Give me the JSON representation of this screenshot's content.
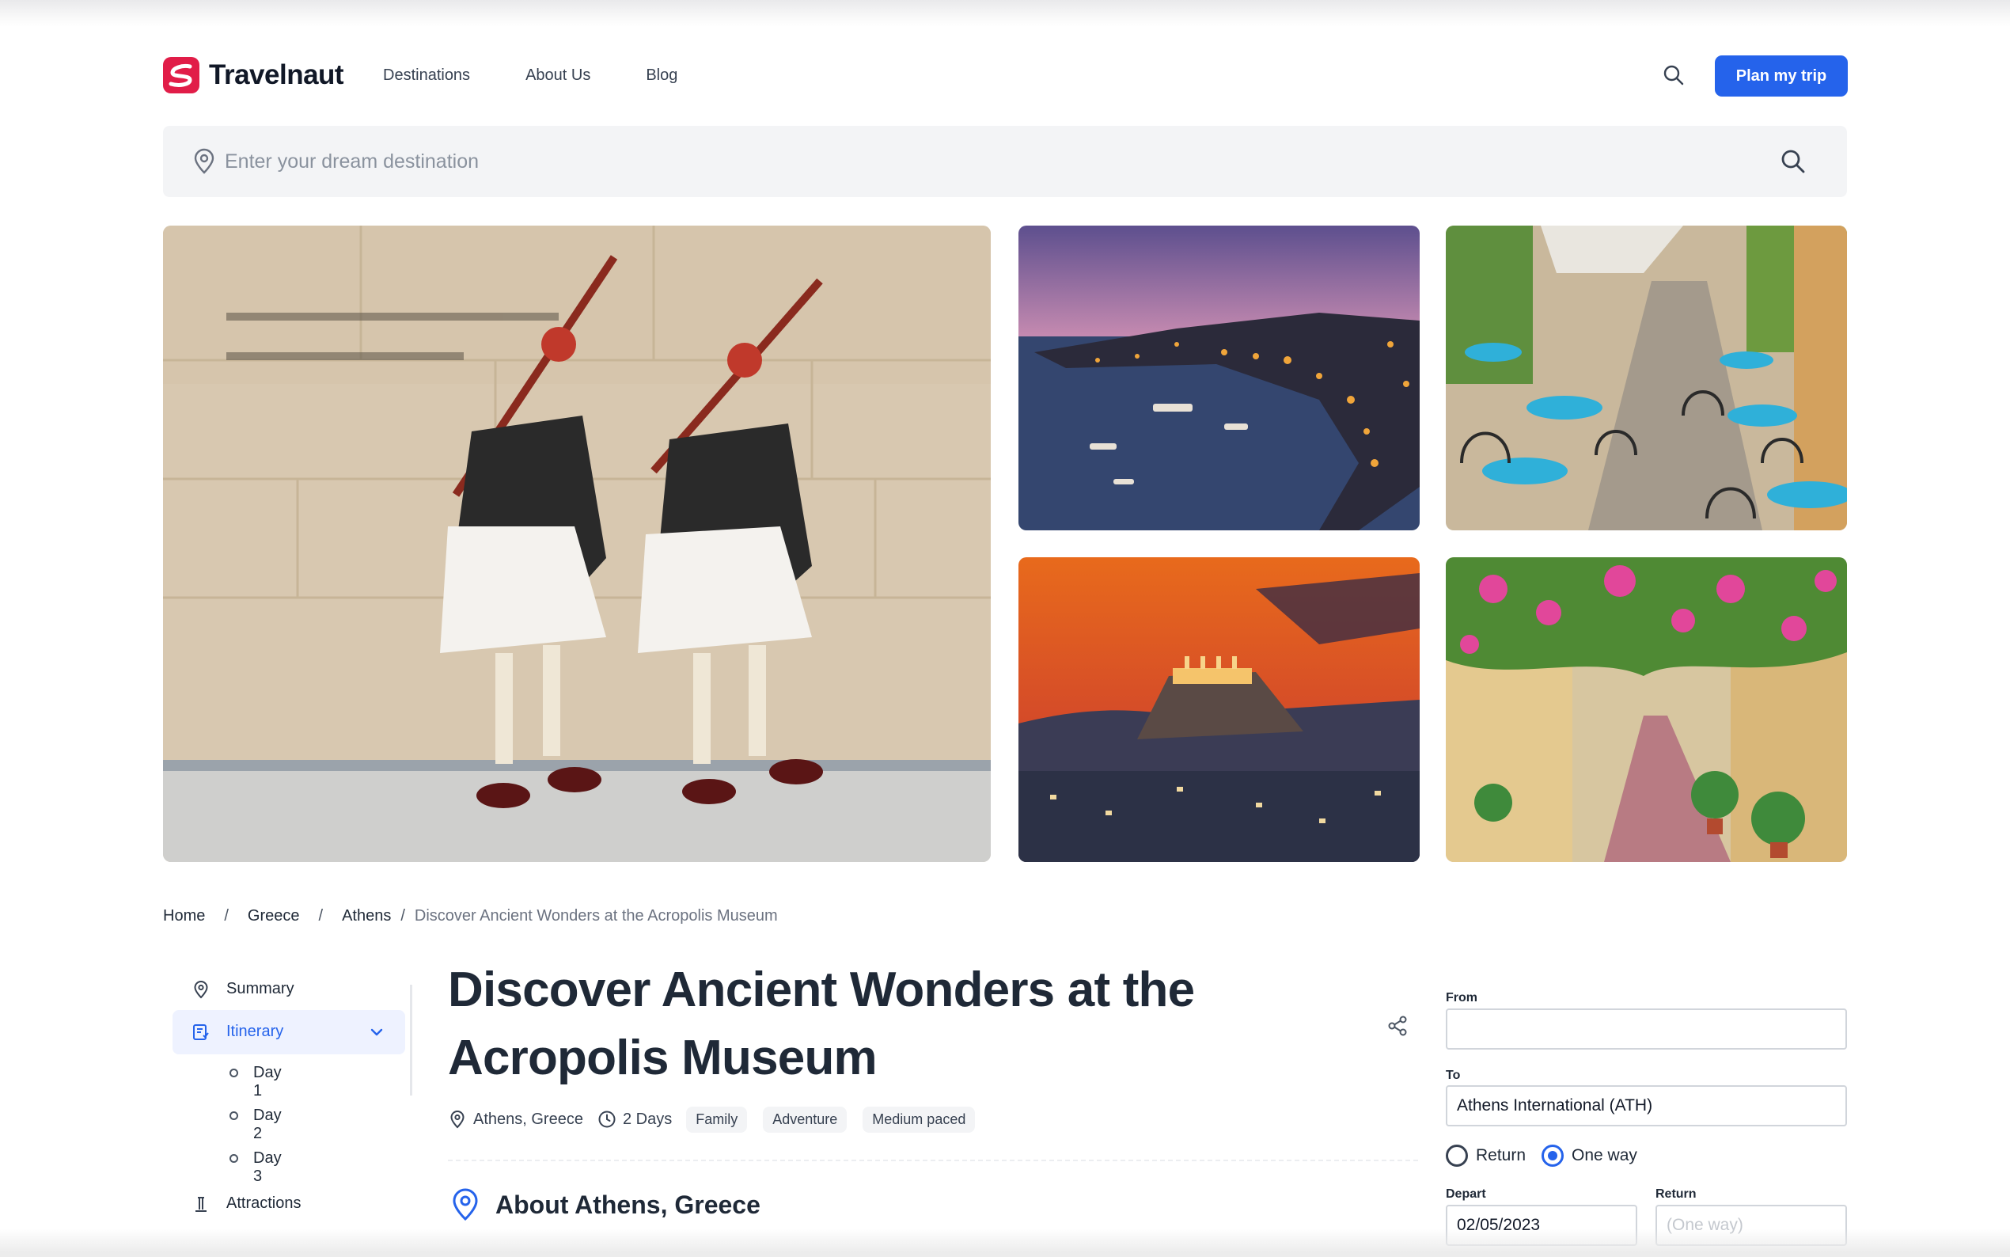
{
  "brand": {
    "name": "Travelnaut",
    "accent": "#e11d48",
    "primary": "#2563eb"
  },
  "nav": {
    "items": [
      "Destinations",
      "About Us",
      "Blog"
    ],
    "cta": "Plan my trip"
  },
  "search": {
    "placeholder": "Enter your dream destination",
    "value": ""
  },
  "gallery": {
    "photos": [
      {
        "subject": "evzones-guards",
        "icon": "photo-evzones-guards"
      },
      {
        "subject": "harbor-at-dusk",
        "icon": "photo-harbor-dusk"
      },
      {
        "subject": "cafe-street",
        "icon": "photo-cafe-street"
      },
      {
        "subject": "acropolis-sunset",
        "icon": "photo-acropolis-sunset"
      },
      {
        "subject": "flower-alley",
        "icon": "photo-flower-alley"
      }
    ]
  },
  "breadcrumb": {
    "items": [
      "Home",
      "Greece",
      "Athens"
    ],
    "current": "Discover Ancient Wonders at the Acropolis Museum",
    "separator": "/"
  },
  "sidebar": {
    "summary": "Summary",
    "itinerary": "Itinerary",
    "days": [
      "Day 1",
      "Day 2",
      "Day 3"
    ],
    "attractions": "Attractions"
  },
  "trip": {
    "title": "Discover Ancient Wonders at the Acropolis Museum",
    "location": "Athens, Greece",
    "duration": "2 Days",
    "tags": [
      "Family",
      "Adventure",
      "Medium paced"
    ],
    "about_heading": "About Athens, Greece"
  },
  "booking": {
    "from_label": "From",
    "from_value": "",
    "to_label": "To",
    "to_value": "Athens International (ATH)",
    "trip_types": [
      "Return",
      "One way"
    ],
    "selected_trip_type": "One way",
    "depart_label": "Depart",
    "depart_value": "02/05/2023",
    "return_label": "Return",
    "return_placeholder": "(One way)"
  }
}
